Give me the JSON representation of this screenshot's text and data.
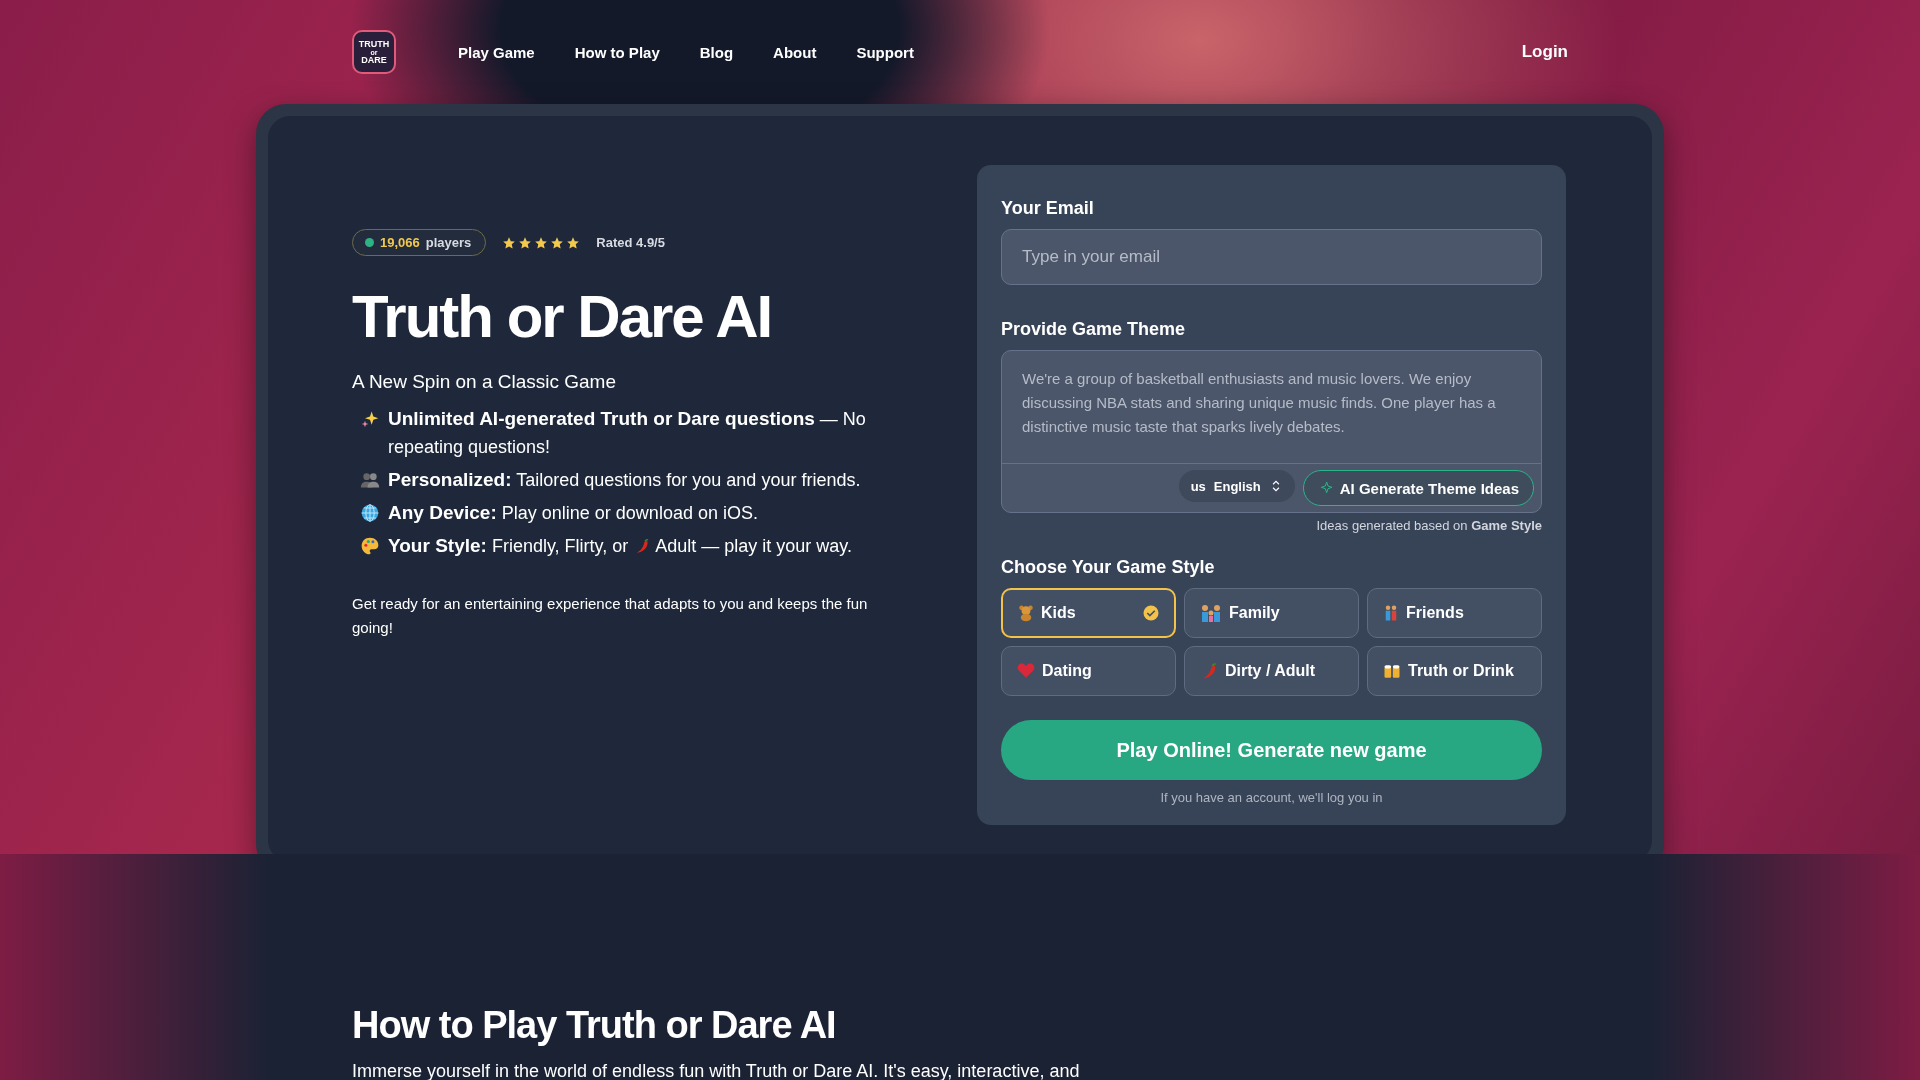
{
  "nav": {
    "logo": [
      "TRUTH",
      "or",
      "DARE"
    ],
    "links": [
      "Play Game",
      "How to Play",
      "Blog",
      "About",
      "Support"
    ],
    "login": "Login"
  },
  "hero": {
    "players": {
      "count": "19,066",
      "label": "players"
    },
    "rating": {
      "stars": 5,
      "label": "Rated 4.9/5"
    },
    "title": "Truth or Dare AI",
    "subtitle": "A New Spin on a Classic Game",
    "features": [
      {
        "text": "**Unlimited AI-generated Truth or Dare questions** — No repeating questions!"
      },
      {
        "text": "**Personalized:** Tailored questions for you and your friends."
      },
      {
        "text": "**Any Device:** Play online or download on iOS."
      },
      {
        "text": "**Your Style:** Friendly, Flirty, or",
        "text_after": "Adult — play it your way."
      }
    ],
    "outro": "Get ready for an entertaining experience that adapts to you and keeps the fun going!"
  },
  "form": {
    "email_label": "Your Email",
    "email_placeholder": "Type in your email",
    "theme_label": "Provide Game Theme",
    "theme_placeholder": "We're a group of basketball enthusiasts and music lovers. We enjoy discussing NBA stats and sharing unique music finds. One player has a distinctive music taste that sparks lively debates.",
    "language": {
      "code": "us",
      "name": "English"
    },
    "generate_button": "AI Generate Theme Ideas",
    "hint": "Ideas generated based on **Game Style**",
    "style_label": "Choose Your Game Style",
    "styles": [
      {
        "label": "Kids",
        "selected": true
      },
      {
        "label": "Family",
        "selected": false
      },
      {
        "label": "Friends",
        "selected": false
      },
      {
        "label": "Dating",
        "selected": false
      },
      {
        "label": "Dirty / Adult",
        "selected": false
      },
      {
        "label": "Truth or Drink",
        "selected": false
      }
    ],
    "play_button": "Play Online! Generate new game",
    "note": "If you have an account, we'll log you in"
  },
  "how_to": {
    "title": "How to Play Truth or Dare AI",
    "text": "Immerse yourself in the world of endless fun with Truth or Dare AI. It's easy, interactive, and"
  }
}
